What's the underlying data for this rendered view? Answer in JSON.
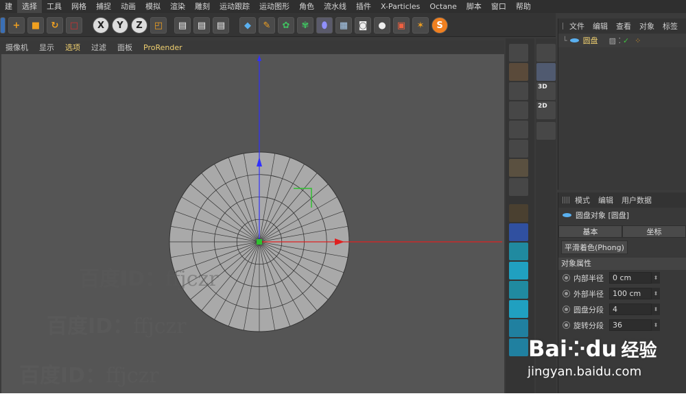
{
  "menu": [
    "建",
    "选择",
    "工具",
    "网格",
    "捕捉",
    "动画",
    "模拟",
    "渲染",
    "雕刻",
    "运动跟踪",
    "运动图形",
    "角色",
    "流水线",
    "插件",
    "X-Particles",
    "Octane",
    "脚本",
    "窗口",
    "帮助"
  ],
  "toolbar": {
    "x": "X",
    "y": "Y",
    "z": "Z"
  },
  "viewport_menu": [
    "摄像机",
    "显示",
    "选项",
    "过滤",
    "面板",
    "ProRender"
  ],
  "object_manager": {
    "tabs": [
      "文件",
      "编辑",
      "查看",
      "对象",
      "标签"
    ],
    "object_name": "圆盘"
  },
  "attributes": {
    "tabs": [
      "模式",
      "编辑",
      "用户数据"
    ],
    "title": "圆盘对象 [圆盘]",
    "tab_basic": "基本",
    "tab_coord": "坐标",
    "phong": "平滑着色(Phong)",
    "section": "对象属性",
    "props": [
      {
        "label": "内部半径",
        "value": "0 cm"
      },
      {
        "label": "外部半径",
        "value": "100 cm"
      },
      {
        "label": "圆盘分段",
        "value": "4"
      },
      {
        "label": "旋转分段",
        "value": "36"
      }
    ],
    "side_labels": {
      "s3d": "3D",
      "s2d": "2D"
    }
  },
  "watermarks": {
    "id": "百度ID：",
    "name": "ffjczr"
  },
  "baidu": {
    "brand": "Bai",
    "paw": "du",
    "jingyan": "经验",
    "url": "jingyan.baidu.com"
  }
}
